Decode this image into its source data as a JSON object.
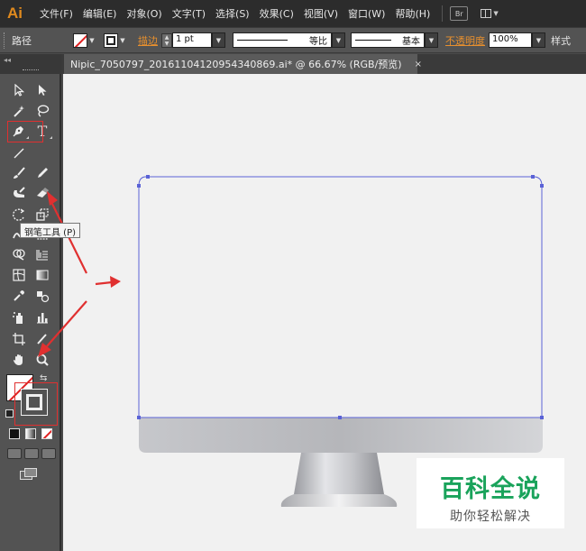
{
  "menubar": {
    "logo": "Ai",
    "items": [
      "文件(F)",
      "编辑(E)",
      "对象(O)",
      "文字(T)",
      "选择(S)",
      "效果(C)",
      "视图(V)",
      "窗口(W)",
      "帮助(H)"
    ],
    "bridge_label": "Br"
  },
  "controlbar": {
    "selection_label": "路径",
    "stroke_label": "描边",
    "stroke_weight": "1 pt",
    "profile_label": "等比",
    "brush_label": "基本",
    "opacity_label": "不透明度",
    "opacity_value": "100%",
    "style_label": "样式"
  },
  "document": {
    "tab_title": "Nipic_7050797_20161104120954340869.ai* @ 66.67% (RGB/预览)",
    "close_glyph": "×"
  },
  "toolbox": {
    "tooltip": "钢笔工具 (P)",
    "panel_collapse": "◂◂"
  },
  "watermark": {
    "main": "百科全说",
    "sub": "助你轻松解决"
  },
  "colors": {
    "accent_orange": "#e8902e",
    "path_blue": "#5a62d6",
    "annotation_red": "#e03030",
    "watermark_green": "#1aa35b"
  }
}
